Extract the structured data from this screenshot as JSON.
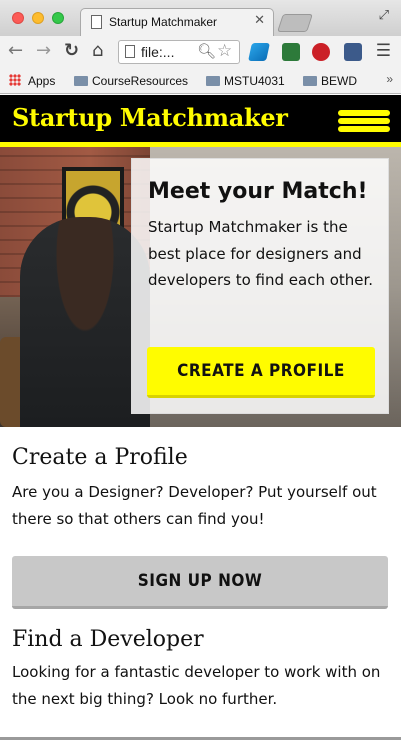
{
  "browser": {
    "tab_title": "Startup Matchmaker",
    "tab_close": "✕",
    "address_value": "file:...",
    "bookmarks": [
      {
        "label": "Apps"
      },
      {
        "label": "CourseResources"
      },
      {
        "label": "MSTU4031"
      },
      {
        "label": "BEWD"
      }
    ],
    "bookmarks_more": "»"
  },
  "site": {
    "title": "Startup Matchmaker",
    "brand_color": "#fffc00"
  },
  "hero": {
    "heading": "Meet your Match!",
    "text": "Startup Matchmaker is the best place for designers and developers to find each other.",
    "cta_label": "CREATE A PROFILE"
  },
  "sections": [
    {
      "heading": "Create a Profile",
      "text": "Are you a Designer? Developer? Put yourself out there so that others can find you!",
      "button_label": "SIGN UP NOW"
    },
    {
      "heading": "Find a Developer",
      "text": "Looking for a fantastic developer to work with on the next big thing? Look no further."
    }
  ],
  "icons": [
    "back-icon",
    "forward-icon",
    "reload-icon",
    "home-icon",
    "page-icon",
    "zoom-icon",
    "star-icon",
    "menu-icon",
    "folder-icon",
    "hamburger-menu-icon"
  ]
}
